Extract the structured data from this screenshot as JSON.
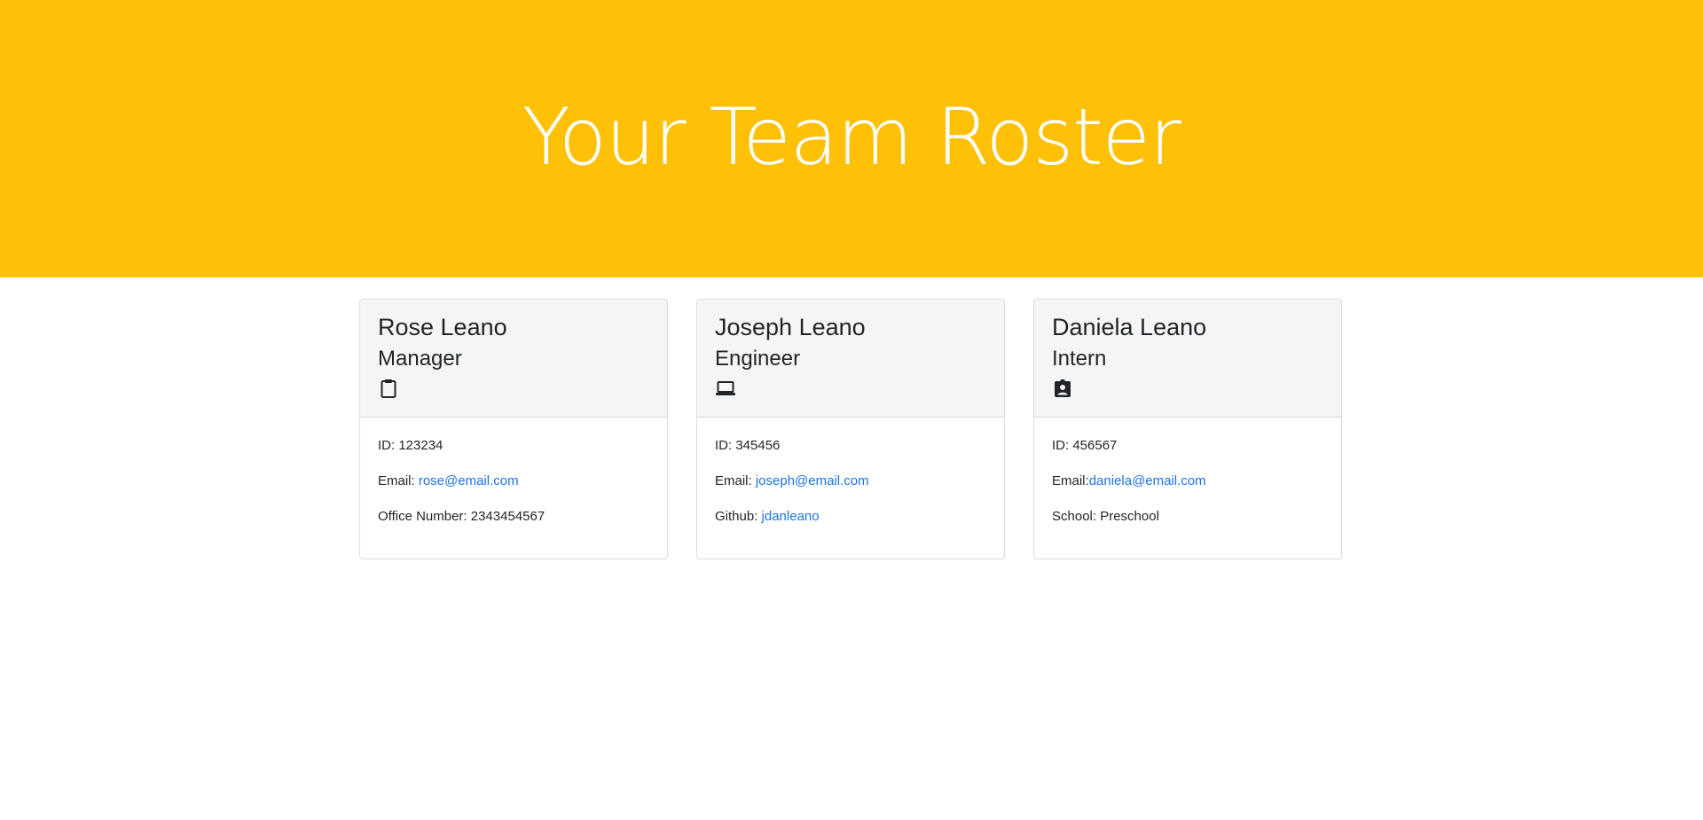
{
  "header": {
    "title": "Your Team Roster"
  },
  "colors": {
    "banner": "#ffc107",
    "link": "#1a73e8"
  },
  "cards": [
    {
      "name": "Rose Leano",
      "role": "Manager",
      "icon": "clipboard-icon",
      "id_label": "ID: ",
      "id": "123234",
      "email_label": "Email: ",
      "email": "rose@email.com",
      "extra_label": "Office Number: ",
      "extra": "2343454567"
    },
    {
      "name": "Joseph Leano",
      "role": "Engineer",
      "icon": "laptop-icon",
      "id_label": "ID: ",
      "id": "345456",
      "email_label": "Email: ",
      "email": "joseph@email.com",
      "extra_label": "Github: ",
      "extra": "jdanleano"
    },
    {
      "name": "Daniela Leano",
      "role": "Intern",
      "icon": "student-badge-icon",
      "id_label": "ID: ",
      "id": "456567",
      "email_label": "Email:",
      "email": "daniela@email.com",
      "extra_label": "School: ",
      "extra": "Preschool"
    }
  ]
}
